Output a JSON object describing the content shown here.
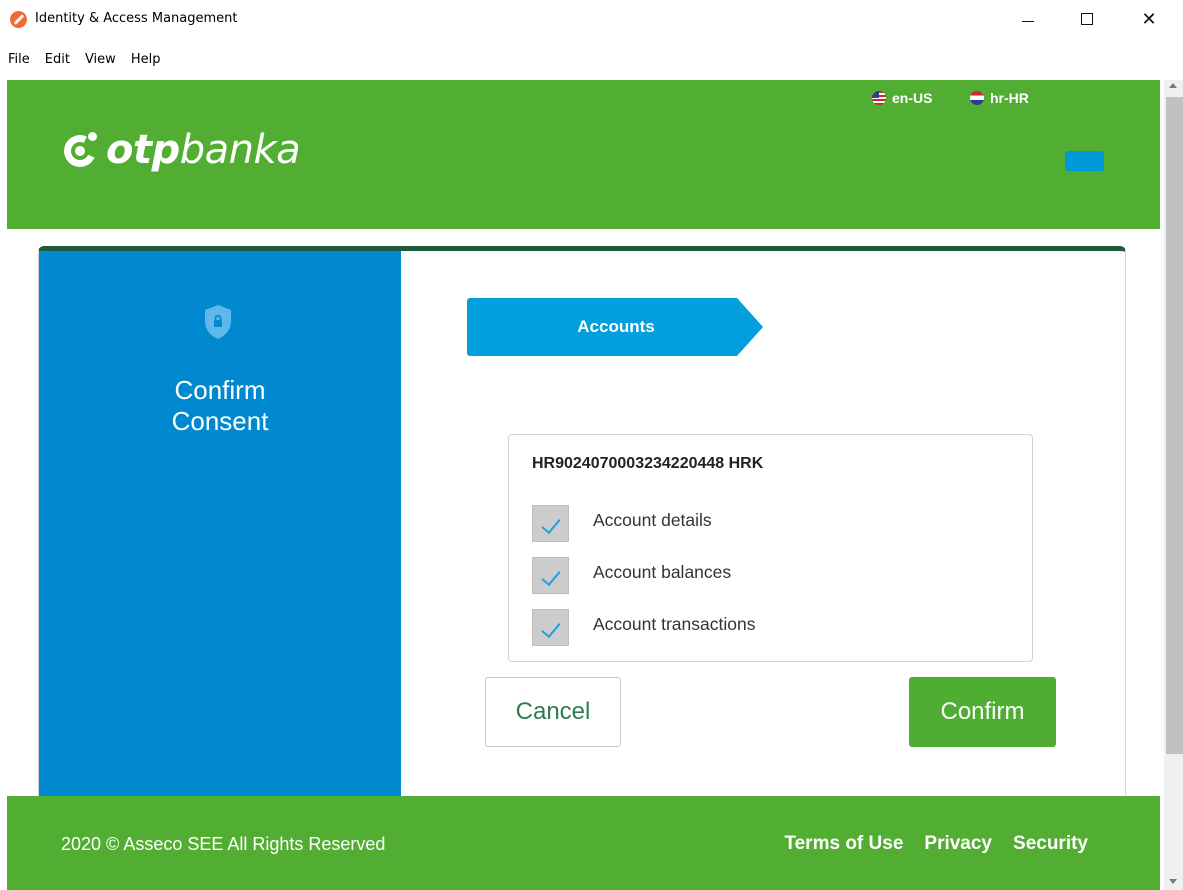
{
  "window": {
    "title": "Identity & Access Management",
    "close_glyph": "✕"
  },
  "menu": [
    "File",
    "Edit",
    "View",
    "Help"
  ],
  "header": {
    "logo_bold": "otp",
    "logo_regular": "banka",
    "languages": [
      {
        "code": "en-US",
        "icon": "us-flag-icon"
      },
      {
        "code": "hr-HR",
        "icon": "hr-flag-icon"
      }
    ],
    "brand_color": "#52ae32"
  },
  "consent": {
    "panel_title_line1": "Confirm",
    "panel_title_line2": "Consent",
    "panel_color": "#0089ce",
    "step_label": "Accounts",
    "account_number": "HR9024070003234220448 HRK",
    "permissions": [
      {
        "label": "Account details",
        "checked": true
      },
      {
        "label": "Account balances",
        "checked": true
      },
      {
        "label": "Account transactions",
        "checked": true
      }
    ],
    "cancel_label": "Cancel",
    "confirm_label": "Confirm"
  },
  "footer": {
    "copyright": "2020 © Asseco SEE All Rights Reserved",
    "links": [
      "Terms of Use",
      "Privacy",
      "Security"
    ]
  }
}
